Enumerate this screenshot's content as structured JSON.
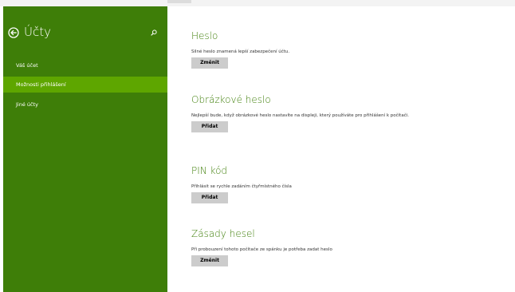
{
  "sidebar": {
    "title": "Účty",
    "items": [
      {
        "label": "Váš účet"
      },
      {
        "label": "Možnosti přihlášení"
      },
      {
        "label": "Jiné účty"
      }
    ]
  },
  "sections": [
    {
      "title": "Heslo",
      "description": "Silné heslo znamená lepší zabezpečení účtu.",
      "button": "Změnit"
    },
    {
      "title": "Obrázkové heslo",
      "description": "Nejlepší bude, když obrázkové heslo nastavíte na displeji, který používáte pro přihlášení k počítači.",
      "button": "Přidat"
    },
    {
      "title": "PIN kód",
      "description": "Přihlásit se rychle zadáním čtyřmístného čísla",
      "button": "Přidat"
    },
    {
      "title": "Zásady hesel",
      "description": "Při probouzení tohoto počítače ze spánku je potřeba zadat heslo",
      "button": "Změnit"
    }
  ],
  "colors": {
    "sidebar_bg": "#3e7e08",
    "sidebar_active": "#5ea600",
    "accent_text": "#3e7e08",
    "button_bg": "#cccccc"
  }
}
